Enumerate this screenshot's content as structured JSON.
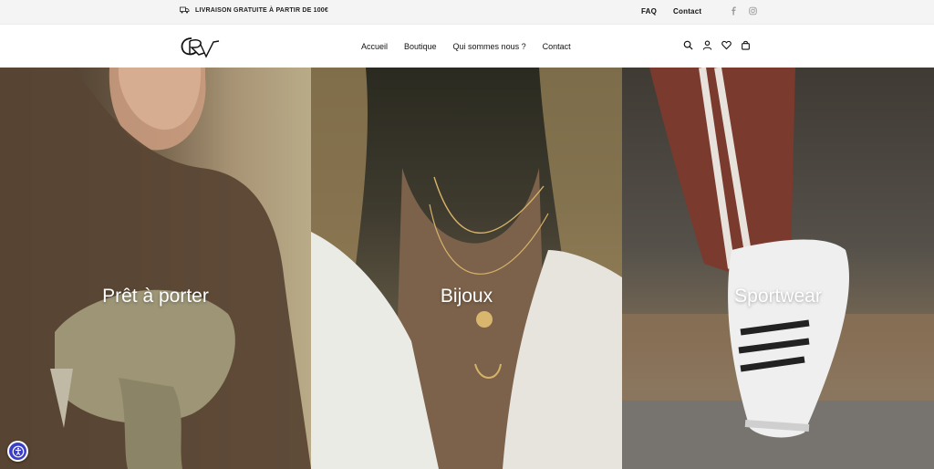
{
  "topbar": {
    "promo_text": "LIVRAISON GRATUITE À PARTIR DE 100€",
    "links": [
      {
        "label": "FAQ"
      },
      {
        "label": "Contact"
      }
    ],
    "social_icons": [
      "facebook-icon",
      "instagram-icon"
    ]
  },
  "header": {
    "logo_alt": "RV",
    "nav": [
      {
        "label": "Accueil"
      },
      {
        "label": "Boutique"
      },
      {
        "label": "Qui sommes nous ?"
      },
      {
        "label": "Contact"
      }
    ],
    "icons": [
      "search-icon",
      "account-icon",
      "wishlist-icon",
      "cart-icon"
    ]
  },
  "panels": [
    {
      "title": "Prêt à porter"
    },
    {
      "title": "Bijoux"
    },
    {
      "title": "Sportwear"
    }
  ],
  "accessibility_button": {
    "icon": "accessibility-icon"
  },
  "colors": {
    "topbar_bg": "#f4f4f4",
    "header_bg": "#ffffff",
    "accessibility_blue": "#3b3ec7"
  }
}
